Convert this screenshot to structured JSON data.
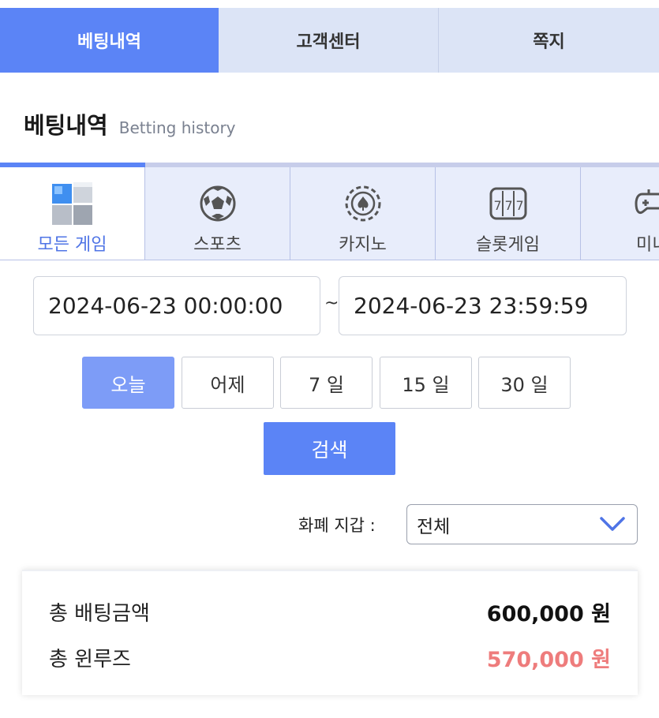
{
  "top_tabs": [
    {
      "label": "베팅내역",
      "active": true
    },
    {
      "label": "고객센터",
      "active": false
    },
    {
      "label": "쪽지",
      "active": false
    }
  ],
  "heading": {
    "title": "베팅내역",
    "subtitle": "Betting history"
  },
  "game_tabs": [
    {
      "label": "모든 게임",
      "icon": "cubes-icon",
      "active": true
    },
    {
      "label": "스포츠",
      "icon": "soccer-ball-icon",
      "active": false
    },
    {
      "label": "카지노",
      "icon": "casino-chip-icon",
      "active": false
    },
    {
      "label": "슬롯게임",
      "icon": "slot-machine-icon",
      "active": false
    },
    {
      "label": "미니",
      "icon": "gamepad-icon",
      "active": false
    }
  ],
  "date_range": {
    "start": "2024-06-23 00:00:00",
    "separator": "~",
    "end": "2024-06-23 23:59:59"
  },
  "quick_ranges": [
    {
      "label": "오늘",
      "active": true
    },
    {
      "label": "어제",
      "active": false
    },
    {
      "label": "7 일",
      "active": false
    },
    {
      "label": "15 일",
      "active": false
    },
    {
      "label": "30 일",
      "active": false
    }
  ],
  "search_label": "검색",
  "wallet": {
    "label": "화폐 지갑 :",
    "selected": "전체"
  },
  "summary": {
    "total_bet_label": "총 배팅금액",
    "total_bet_value": "600,000 원",
    "total_winloss_label": "총 윈루즈",
    "total_winloss_value": "570,000 원"
  },
  "colors": {
    "accent": "#5b84f6",
    "accent_light": "#7d9cf7",
    "tab_bg": "#dce4f6",
    "loss_red": "#ee7c7c"
  }
}
